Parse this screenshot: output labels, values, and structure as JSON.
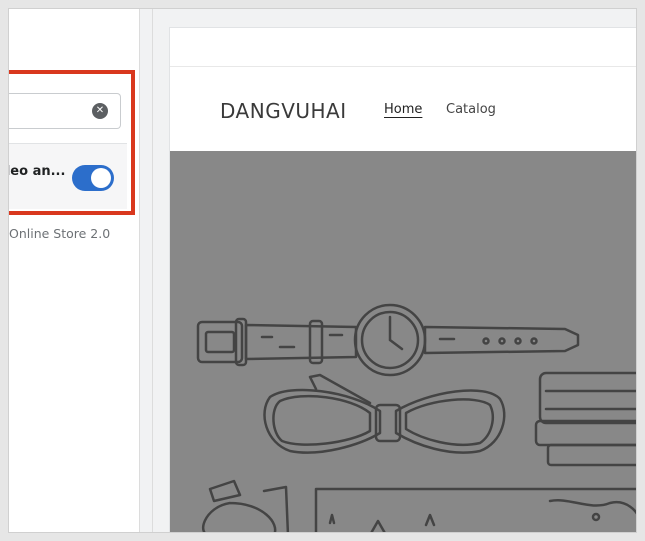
{
  "sidebar": {
    "search": {
      "value": "",
      "placeholder": ""
    },
    "toggle_setting": {
      "label": "deo an...",
      "enabled": true
    },
    "store_version_label": "Online Store 2.0"
  },
  "preview": {
    "header": {
      "store_name": "DANGVUHAI",
      "nav": [
        {
          "label": "Home",
          "active": true
        },
        {
          "label": "Catalog",
          "active": false
        }
      ]
    },
    "hero": {
      "background_color": "#888888",
      "illustration": "lifestyle-products-illustration"
    }
  },
  "colors": {
    "highlight_border": "#d9381e",
    "toggle_on": "#2c6ecb"
  }
}
